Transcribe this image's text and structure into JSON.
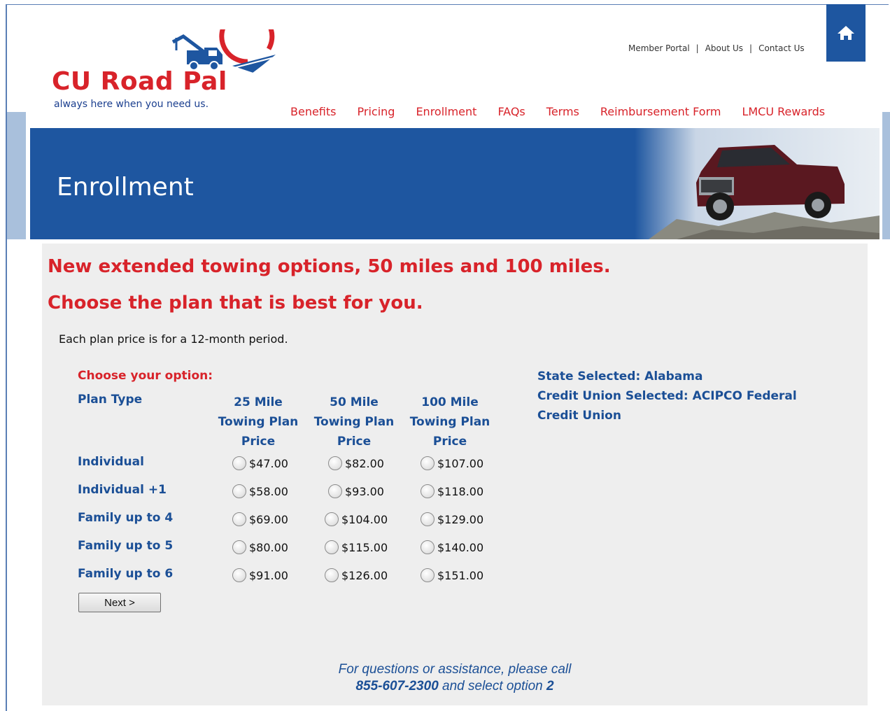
{
  "brand": {
    "title": "CU Road Pal",
    "tagline": "always here when you need us."
  },
  "top_links": [
    "Member Portal",
    "About Us",
    "Contact Us"
  ],
  "nav": [
    "Benefits",
    "Pricing",
    "Enrollment",
    "FAQs",
    "Terms",
    "Reimbursement Form",
    "LMCU Rewards"
  ],
  "banner": {
    "title": "Enrollment"
  },
  "main": {
    "headline1": "New extended towing options, 50 miles and 100 miles.",
    "headline2": "Choose the plan that is best for you.",
    "note": "Each plan price is for a 12-month period.",
    "choose_label": "Choose your option:",
    "plan_type_header": "Plan Type",
    "columns": [
      [
        "25 Mile",
        "Towing Plan",
        "Price"
      ],
      [
        "50 Mile",
        "Towing Plan",
        "Price"
      ],
      [
        "100 Mile",
        "Towing Plan",
        "Price"
      ]
    ],
    "rows": [
      {
        "label": "Individual",
        "prices": [
          "$47.00",
          "$82.00",
          "$107.00"
        ]
      },
      {
        "label": "Individual +1",
        "prices": [
          "$58.00",
          "$93.00",
          "$118.00"
        ]
      },
      {
        "label": "Family up to 4",
        "prices": [
          "$69.00",
          "$104.00",
          "$129.00"
        ]
      },
      {
        "label": "Family up to 5",
        "prices": [
          "$80.00",
          "$115.00",
          "$140.00"
        ]
      },
      {
        "label": "Family up to 6",
        "prices": [
          "$91.00",
          "$126.00",
          "$151.00"
        ]
      }
    ],
    "next_label": "Next >",
    "state_selected": "State Selected: Alabama",
    "cu_selected": "Credit Union Selected: ACIPCO Federal Credit Union"
  },
  "footer": {
    "line1": "For questions or assistance, please call",
    "phone": "855-607-2300",
    "mid": " and select option ",
    "option": "2"
  },
  "colors": {
    "brand_red": "#d8232a",
    "brand_blue": "#1e56a0",
    "text_blue": "#1b4f96",
    "panel_grey": "#eeeeee"
  },
  "icons": [
    "tow-truck-logo-icon",
    "home-icon"
  ]
}
